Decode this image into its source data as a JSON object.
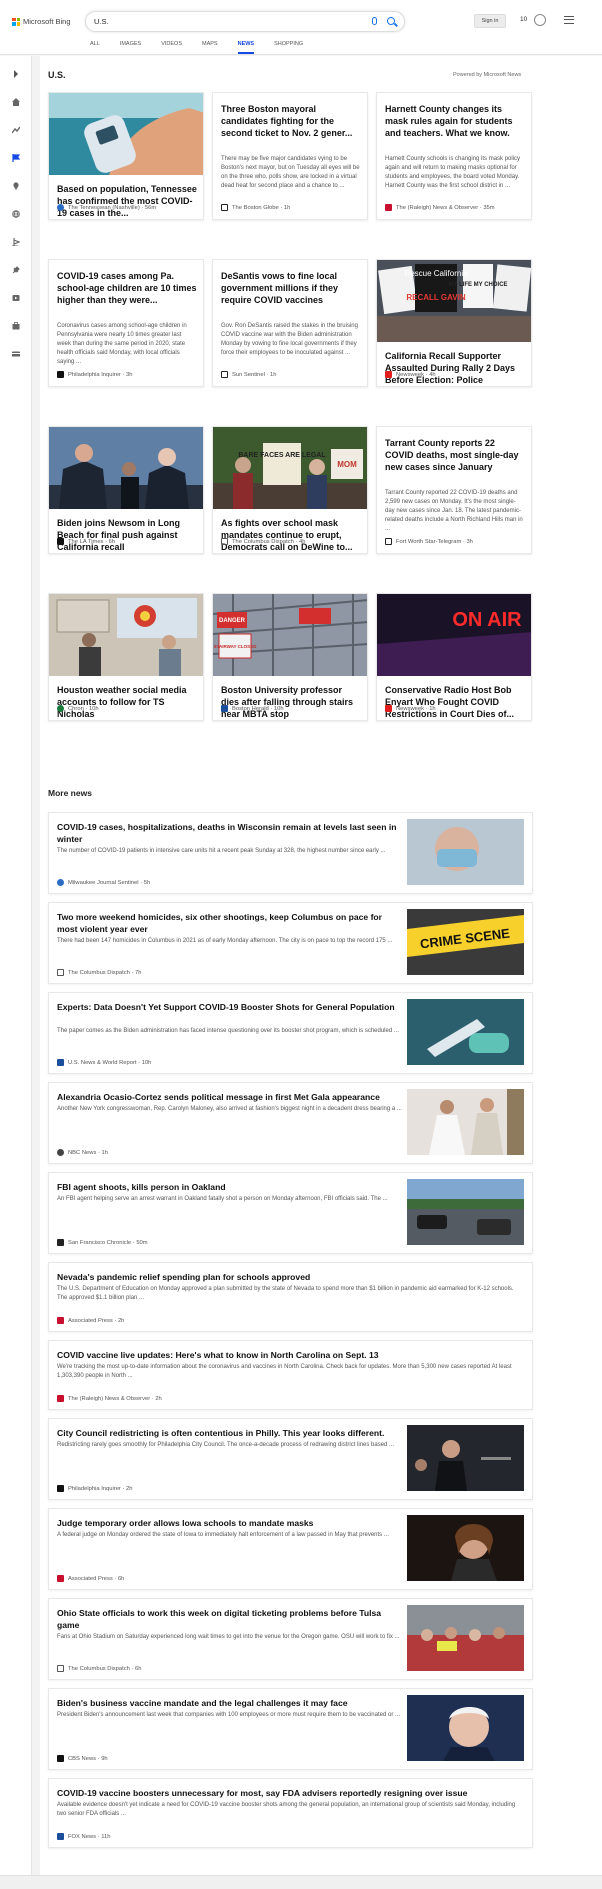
{
  "header": {
    "brand": "Microsoft Bing",
    "query": "U.S.",
    "sign_in": "Sign in",
    "rewards_count": "10"
  },
  "nav": [
    "ALL",
    "IMAGES",
    "VIDEOS",
    "MAPS",
    "NEWS",
    "SHOPPING"
  ],
  "active_nav": "NEWS",
  "section": {
    "title": "U.S.",
    "powered_by": "Powered by Microsoft News"
  },
  "cards": [
    {
      "title": "Based on population, Tennessee has confirmed the most COVID-19 cases in the...",
      "snippet": "",
      "source": "The Tennessean (Nashville)",
      "time": "56m",
      "image": "thermometer-scan",
      "src_color": "#2b6cc4"
    },
    {
      "title": "Three Boston mayoral candidates fighting for the second ticket to Nov. 2 gener...",
      "snippet": "There may be five major candidates vying to be Boston's next mayor, but on Tuesday all eyes will be on the three who, polls show, are locked in a virtual dead heat for second place and a chance to ...",
      "source": "The Boston Globe",
      "time": "1h",
      "image": "",
      "src_color": "#222222"
    },
    {
      "title": "Harnett County changes its mask rules again for students and teachers. What we know.",
      "snippet": "Harnett County schools is changing its mask policy again and will return to making masks optional for students and employees, the board voted Monday. Harnett County was the first school district in ...",
      "source": "The (Raleigh) News & Observer",
      "time": "35m",
      "image": "",
      "src_color": "#c8102e"
    },
    {
      "title": "COVID-19 cases among Pa. school-age children are 10 times higher than they were...",
      "snippet": "Coronavirus cases among school-age children in Pennsylvania were nearly 10 times greater last week than during the same period in 2020, state health officials said Monday, with local officials saying ...",
      "source": "Philadelphia Inquirer",
      "time": "3h",
      "image": "",
      "src_color": "#111111"
    },
    {
      "title": "DeSantis vows to fine local government millions if they require COVID vaccines",
      "snippet": "Gov. Ron DeSantis raised the stakes in the bruising COVID vaccine war with the Biden administration Monday by vowing to fine local governments if they force their employees to be inoculated against ...",
      "source": "Sun Sentinel",
      "time": "1h",
      "image": "",
      "src_color": "#222222"
    },
    {
      "title": "California Recall Supporter Assaulted During Rally 2 Days Before Election: Police",
      "snippet": "",
      "source": "Newsweek",
      "time": "4h",
      "image": "protest-signs",
      "src_color": "#e01e1e",
      "sign_text": [
        "Rescue California",
        "RECALL GAVIN",
        "MY LIFE MY CHOICE"
      ]
    },
    {
      "title": "Biden joins Newsom in Long Beach for final push against California recall",
      "snippet": "",
      "source": "The LA Times",
      "time": "6h",
      "image": "politicians",
      "src_color": "#111111"
    },
    {
      "title": "As fights over school mask mandates continue to erupt, Democrats call on DeWine to...",
      "snippet": "",
      "source": "The Columbus Dispatch",
      "time": "4h",
      "image": "mask-protest",
      "src_color": "#555555",
      "sign_text": [
        "BARE FACES ARE LEGAL",
        "MOM"
      ]
    },
    {
      "title": "Tarrant County reports 22 COVID deaths, most single-day new cases since January",
      "snippet": "Tarrant County reported 22 COVID-19 deaths and 2,599 new cases on Monday. It's the most single-day new cases since Jan. 18. The latest pandemic-related deaths include a North Richland Hills man in ...",
      "source": "Fort Worth Star-Telegram",
      "time": "3h",
      "image": "",
      "src_color": "#222222"
    },
    {
      "title": "Houston weather social media accounts to follow for TS Nicholas",
      "snippet": "",
      "source": "Chron",
      "time": "10h",
      "image": "weather-room",
      "src_color": "#1a7a3c"
    },
    {
      "title": "Boston University professor dies after falling through stairs near MBTA stop",
      "snippet": "",
      "source": "Boston Herald",
      "time": "10h",
      "image": "closed-stairs",
      "src_color": "#1b4f9c",
      "sign_text": [
        "DANGER",
        "STAIRWAY CLOSED"
      ]
    },
    {
      "title": "Conservative Radio Host Bob Enyart Who Fought COVID Restrictions in Court Dies of...",
      "snippet": "",
      "source": "Newsweek",
      "time": "1h",
      "image": "on-air",
      "src_color": "#e01e1e",
      "sign_text": [
        "ON AIR"
      ]
    }
  ],
  "more_news": {
    "title": "More news",
    "items": [
      {
        "title": "COVID-19 cases, hospitalizations, deaths in Wisconsin remain at levels last seen in winter",
        "snippet": "The number of COVID-19 patients in intensive care units hit a recent peak Sunday at 328, the highest number since early ...",
        "source": "Milwaukee Journal Sentinel",
        "time": "5h",
        "image": "masked-person",
        "src_color": "#2b6cc4"
      },
      {
        "title": "Two more weekend homicides, six other shootings, keep Columbus on pace for most violent year ever",
        "snippet": "There had been 147 homicides in Columbus in 2021 as of early Monday afternoon. The city is on pace to top the record 175 ...",
        "source": "The Columbus Dispatch",
        "time": "7h",
        "image": "crime-tape",
        "src_color": "#555555",
        "image_text": "CRIME SCENE"
      },
      {
        "title": "Experts: Data Doesn't Yet Support COVID-19 Booster Shots for General Population",
        "snippet": "The paper comes as the Biden administration has faced intense questioning over its booster shot program, which is scheduled ...",
        "source": "U.S. News & World Report",
        "time": "10h",
        "image": "vaccine",
        "src_color": "#1b4f9c"
      },
      {
        "title": "Alexandria Ocasio-Cortez sends political message in first Met Gala appearance",
        "snippet": "Another New York congresswoman, Rep. Carolyn Maloney, also arrived at fashion's biggest night in a decadent dress bearing a ...",
        "source": "NBC News",
        "time": "1h",
        "image": "gala",
        "src_color": "#444444"
      },
      {
        "title": "FBI agent shoots, kills person in Oakland",
        "snippet": "An FBI agent helping serve an arrest warrant in Oakland fatally shot a person on Monday afternoon, FBI officials said. The ...",
        "source": "San Francisco Chronicle",
        "time": "50m",
        "image": "street",
        "src_color": "#222222"
      },
      {
        "title": "Nevada's pandemic relief spending plan for schools approved",
        "snippet": "The U.S. Department of Education on Monday approved a plan submitted by the state of Nevada to spend more than $1 billion in pandemic aid earmarked for K-12 schools. The approved $1.1 billion plan ...",
        "source": "Associated Press",
        "time": "2h",
        "image": "",
        "src_color": "#c8102e"
      },
      {
        "title": "COVID vaccine live updates: Here's what to know in North Carolina on Sept. 13",
        "snippet": "We're tracking the most up-to-date information about the coronavirus and vaccines in North Carolina. Check back for updates. More than 5,300 new cases reported At least 1,303,390 people in North ...",
        "source": "The (Raleigh) News & Observer",
        "time": "2h",
        "image": "",
        "src_color": "#c8102e"
      },
      {
        "title": "City Council redistricting is often contentious in Philly. This year looks different.",
        "snippet": "Redistricting rarely goes smoothly for Philadelphia City Council. The once-a-decade process of redrawing district lines based ...",
        "source": "Philadelphia Inquirer",
        "time": "2h",
        "image": "council",
        "src_color": "#111111"
      },
      {
        "title": "Judge temporary order allows Iowa schools to mandate masks",
        "snippet": "A federal judge on Monday ordered the state of Iowa to immediately halt enforcement of a law passed in May that prevents ...",
        "source": "Associated Press",
        "time": "6h",
        "image": "portrait-dark",
        "src_color": "#c8102e"
      },
      {
        "title": "Ohio State officials to work this week on digital ticketing problems before Tulsa game",
        "snippet": "Fans at Ohio Stadium on Saturday experienced long wait times to get into the venue for the Oregon game. OSU will work to fix ...",
        "source": "The Columbus Dispatch",
        "time": "6h",
        "image": "crowd",
        "src_color": "#555555"
      },
      {
        "title": "Biden's business vaccine mandate and the legal challenges it may face",
        "snippet": "President Biden's announcement last week that companies with 100 employees or more must require them to be vaccinated or ...",
        "source": "CBS News",
        "time": "9h",
        "image": "biden-portrait",
        "src_color": "#111111"
      },
      {
        "title": "COVID-19 vaccine boosters unnecessary for most, say FDA advisers reportedly resigning over issue",
        "snippet": "Available evidence doesn't yet indicate a need for COVID-19 vaccine booster shots among the general population, an international group of scientists said Monday, including two senior FDA officials ...",
        "source": "FOX News",
        "time": "11h",
        "image": "",
        "src_color": "#1b4f9c"
      }
    ]
  }
}
